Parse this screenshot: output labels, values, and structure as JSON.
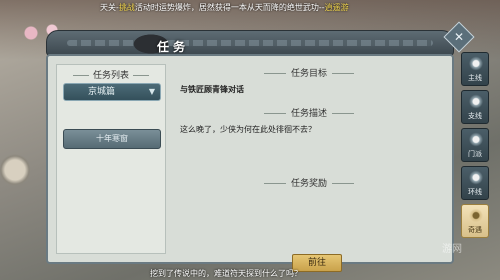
{
  "broadcast": {
    "prefix": "天关-",
    "highlight": "挑战",
    "message": "活动时运势爆炸，居然获得一本从天而降的绝世武功--",
    "item": "逍遥游"
  },
  "panel": {
    "title": "任务",
    "close_label": "✕"
  },
  "task_list": {
    "header": "任务列表",
    "category": "京城篇",
    "items": [
      "十年寒窗"
    ]
  },
  "task_detail": {
    "goal_header": "任务目标",
    "goal_text": "与铁匠顾青锋对话",
    "desc_header": "任务描述",
    "desc_text": "这么晚了，少侠为何在此处徘徊不去？",
    "reward_header": "任务奖励",
    "go_label": "前往"
  },
  "side_tabs": [
    {
      "label": "主线",
      "icon": "main-quest-icon"
    },
    {
      "label": "支线",
      "icon": "side-quest-icon"
    },
    {
      "label": "门派",
      "icon": "sect-icon"
    },
    {
      "label": "环线",
      "icon": "loop-quest-icon"
    },
    {
      "label": "奇遇",
      "icon": "adventure-icon",
      "active": true
    }
  ],
  "chat": {
    "prefix": "",
    "highlight": "",
    "message": "挖到了传说中的",
    "tail": "，难道符天探到什么了吗？"
  },
  "watermark": "游网"
}
